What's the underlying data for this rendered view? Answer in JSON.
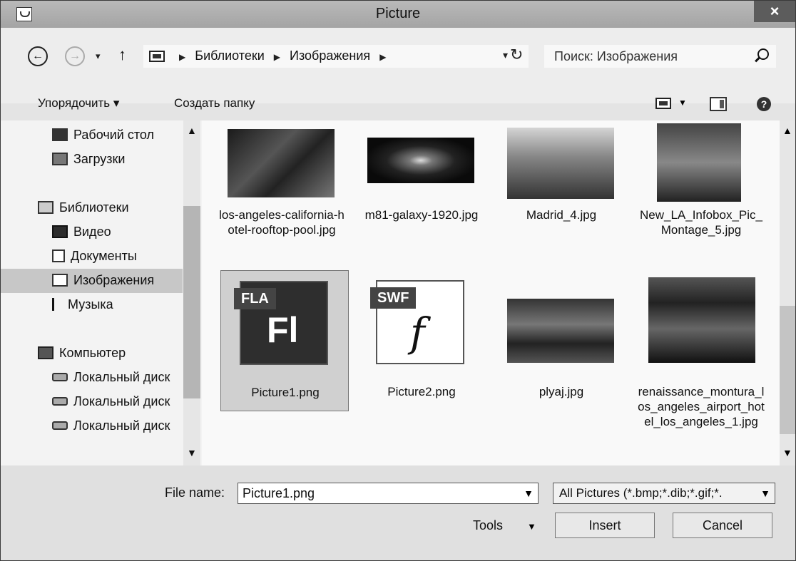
{
  "window": {
    "title": "Picture",
    "close_label": "×"
  },
  "nav": {
    "back_label": "←",
    "forward_label": "→",
    "recent_label": "▾",
    "up_label": "↑",
    "breadcrumbs": [
      "Библиотеки",
      "Изображения"
    ],
    "refresh_label": "↻",
    "search_placeholder": "Поиск: Изображения"
  },
  "toolbar": {
    "organize_label": "Упорядочить ▾",
    "new_folder_label": "Создать папку",
    "help_label": "?"
  },
  "sidebar": {
    "items": [
      {
        "label": "Рабочий стол",
        "icon": "desktop-icon"
      },
      {
        "label": "Загрузки",
        "icon": "downloads-icon"
      },
      {
        "label": "Библиотеки",
        "icon": "libraries-icon"
      },
      {
        "label": "Видео",
        "icon": "video-icon"
      },
      {
        "label": "Документы",
        "icon": "documents-icon"
      },
      {
        "label": "Изображения",
        "icon": "pictures-icon"
      },
      {
        "label": "Музыка",
        "icon": "music-icon"
      },
      {
        "label": "Компьютер",
        "icon": "computer-icon"
      },
      {
        "label": "Локальный диск",
        "icon": "disk-icon"
      },
      {
        "label": "Локальный диск",
        "icon": "disk-icon"
      },
      {
        "label": "Локальный диск",
        "icon": "disk-icon"
      }
    ],
    "selected": "Изображения"
  },
  "files": [
    {
      "name": "los-angeles-california-hotel-rooftop-pool.jpg",
      "kind": "photo"
    },
    {
      "name": "m81-galaxy-1920.jpg",
      "kind": "photo"
    },
    {
      "name": "Madrid_4.jpg",
      "kind": "photo"
    },
    {
      "name": "New_LA_Infobox_Pic_Montage_5.jpg",
      "kind": "photo"
    },
    {
      "name": "Picture1.png",
      "kind": "fla-icon",
      "tag": "FLA",
      "glyph": "Fl",
      "selected": true
    },
    {
      "name": "Picture2.png",
      "kind": "swf-icon",
      "tag": "SWF",
      "glyph": "f"
    },
    {
      "name": "plyaj.jpg",
      "kind": "photo"
    },
    {
      "name": "renaissance_montura_los_angeles_airport_hotel_los_angeles_1.jpg",
      "kind": "photo"
    }
  ],
  "footer": {
    "file_name_label": "File name:",
    "file_name_value": "Picture1.png",
    "filter_value": "All Pictures (*.bmp;*.dib;*.gif;*.",
    "tools_label": "Tools",
    "insert_label": "Insert",
    "cancel_label": "Cancel"
  }
}
